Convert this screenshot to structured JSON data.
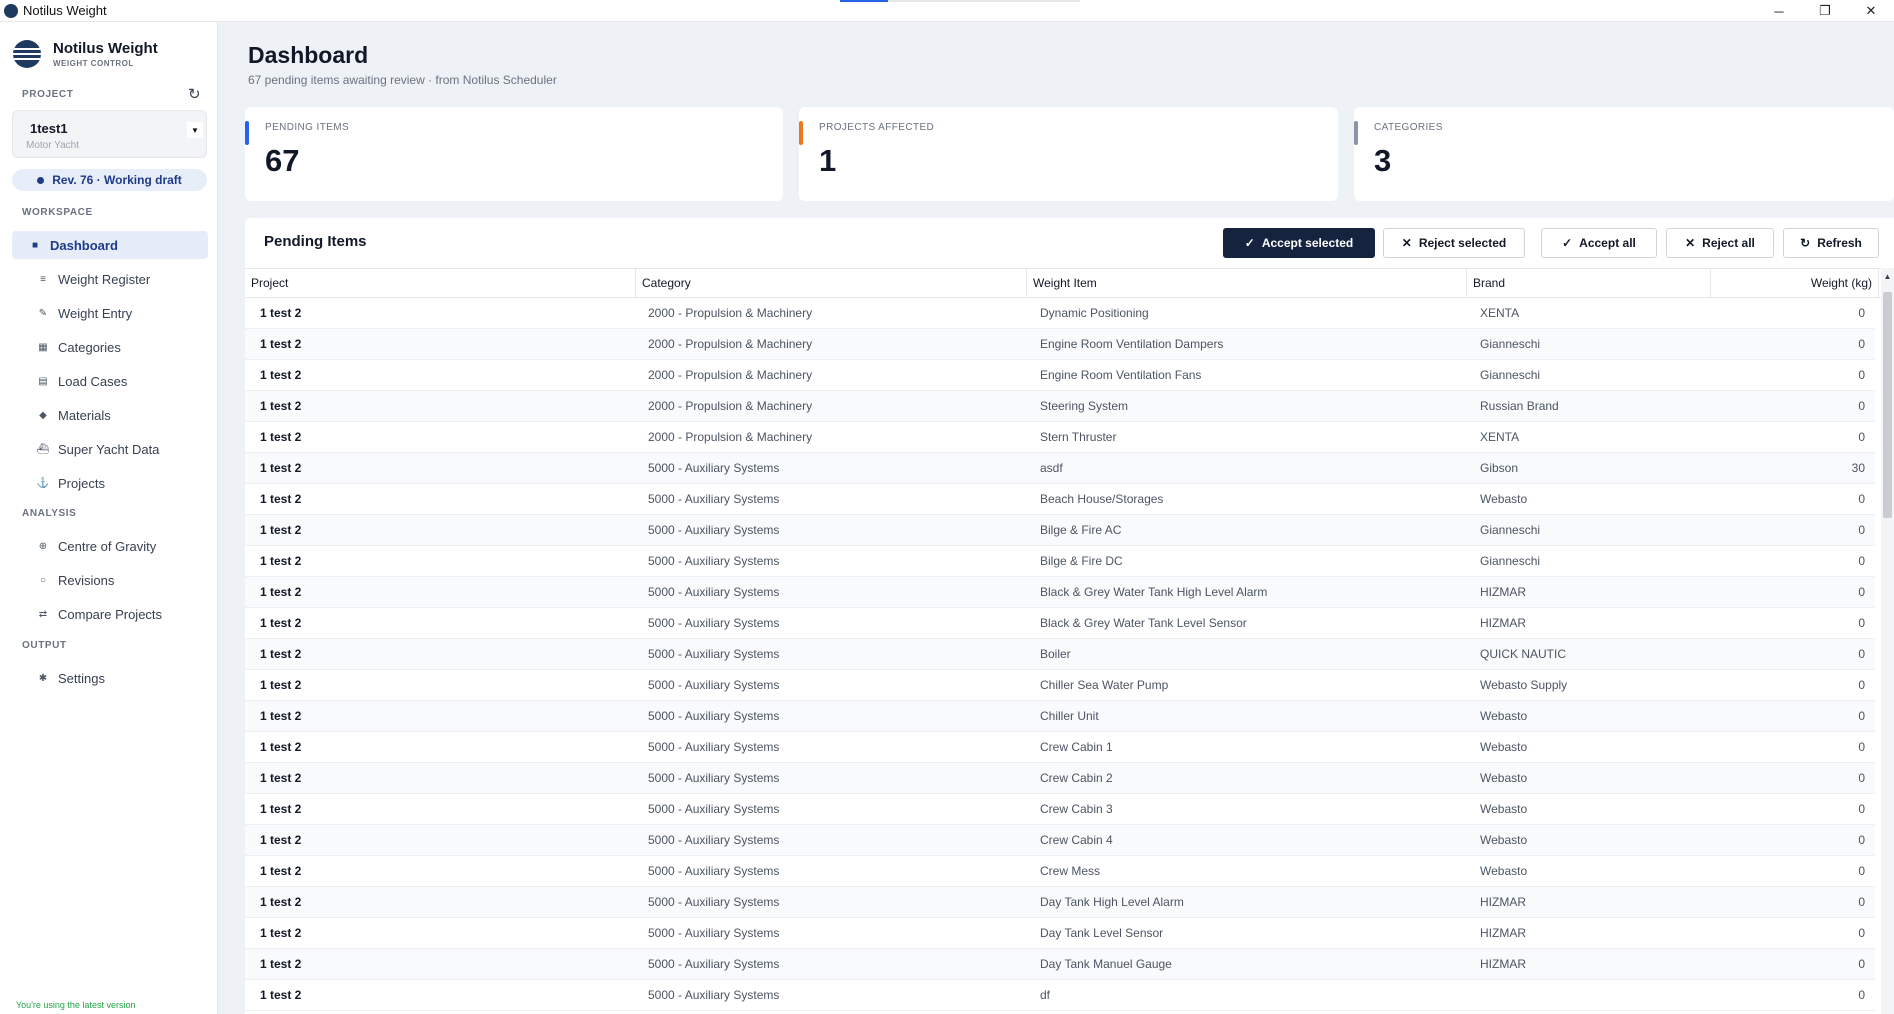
{
  "window": {
    "title": "Notilus Weight",
    "minimize_glyph": "─",
    "maximize_glyph": "❐",
    "close_glyph": "✕",
    "loading_progress": 0.2
  },
  "sidebar": {
    "brand_name": "Notilus Weight",
    "brand_sub": "WEIGHT CONTROL",
    "project_label": "PROJECT",
    "refresh_glyph": "↻",
    "project": {
      "name": "1test1",
      "type": "Motor Yacht",
      "caret": "▼"
    },
    "revision": "Rev. 76  ·  Working draft",
    "sections": {
      "workspace": "WORKSPACE",
      "analysis": "ANALYSIS",
      "output": "OUTPUT"
    },
    "nav": {
      "dashboard": {
        "label": "Dashboard",
        "icon": "■"
      },
      "weight_register": {
        "label": "Weight Register",
        "icon": "≡"
      },
      "weight_entry": {
        "label": "Weight Entry",
        "icon": "✎"
      },
      "categories": {
        "label": "Categories",
        "icon": "▦"
      },
      "load_cases": {
        "label": "Load Cases",
        "icon": "▤"
      },
      "materials": {
        "label": "Materials",
        "icon": "◆"
      },
      "super_yacht_data": {
        "label": "Super Yacht Data",
        "icon": "⛴"
      },
      "projects": {
        "label": "Projects",
        "icon": "⚓"
      },
      "centre_of_gravity": {
        "label": "Centre of Gravity",
        "icon": "⊕"
      },
      "revisions": {
        "label": "Revisions",
        "icon": "○"
      },
      "compare_projects": {
        "label": "Compare Projects",
        "icon": "⇄"
      },
      "settings": {
        "label": "Settings",
        "icon": "✱"
      }
    },
    "version_note": "You're using the latest version"
  },
  "header": {
    "title": "Dashboard",
    "subtitle": "67 pending items awaiting review · from Notilus Scheduler"
  },
  "stats": {
    "pending": {
      "label": "PENDING ITEMS",
      "value": "67",
      "color": "#2563eb"
    },
    "projects": {
      "label": "PROJECTS AFFECTED",
      "value": "1",
      "color": "#ea7a1b"
    },
    "categories": {
      "label": "CATEGORIES",
      "value": "3",
      "color": "#8b93a7"
    }
  },
  "panel": {
    "title": "Pending Items",
    "buttons": {
      "accept_selected": {
        "label": "Accept selected",
        "icon": "✓"
      },
      "reject_selected": {
        "label": "Reject selected",
        "icon": "✕"
      },
      "accept_all": {
        "label": "Accept all",
        "icon": "✓"
      },
      "reject_all": {
        "label": "Reject all",
        "icon": "✕"
      },
      "refresh": {
        "label": "Refresh",
        "icon": "↻"
      }
    },
    "columns": {
      "project": "Project",
      "category": "Category",
      "item": "Weight Item",
      "brand": "Brand",
      "weight": "Weight (kg)"
    },
    "scroll_up_glyph": "▲",
    "rows": [
      {
        "project": "1 test 2",
        "category": "2000 - Propulsion & Machinery",
        "item": "Dynamic Positioning",
        "brand": "XENTA",
        "weight": "0"
      },
      {
        "project": "1 test 2",
        "category": "2000 - Propulsion & Machinery",
        "item": "Engine Room Ventilation Dampers",
        "brand": "Gianneschi",
        "weight": "0"
      },
      {
        "project": "1 test 2",
        "category": "2000 - Propulsion & Machinery",
        "item": "Engine Room Ventilation Fans",
        "brand": "Gianneschi",
        "weight": "0"
      },
      {
        "project": "1 test 2",
        "category": "2000 - Propulsion & Machinery",
        "item": "Steering System",
        "brand": "Russian Brand",
        "weight": "0"
      },
      {
        "project": "1 test 2",
        "category": "2000 - Propulsion & Machinery",
        "item": "Stern Thruster",
        "brand": "XENTA",
        "weight": "0"
      },
      {
        "project": "1 test 2",
        "category": "5000 - Auxiliary Systems",
        "item": "asdf",
        "brand": "Gibson",
        "weight": "30"
      },
      {
        "project": "1 test 2",
        "category": "5000 - Auxiliary Systems",
        "item": "Beach House/Storages",
        "brand": "Webasto",
        "weight": "0"
      },
      {
        "project": "1 test 2",
        "category": "5000 - Auxiliary Systems",
        "item": "Bilge & Fire AC",
        "brand": "Gianneschi",
        "weight": "0"
      },
      {
        "project": "1 test 2",
        "category": "5000 - Auxiliary Systems",
        "item": "Bilge & Fire DC",
        "brand": "Gianneschi",
        "weight": "0"
      },
      {
        "project": "1 test 2",
        "category": "5000 - Auxiliary Systems",
        "item": "Black & Grey Water Tank High Level Alarm",
        "brand": "HIZMAR",
        "weight": "0"
      },
      {
        "project": "1 test 2",
        "category": "5000 - Auxiliary Systems",
        "item": "Black & Grey Water Tank Level Sensor",
        "brand": "HIZMAR",
        "weight": "0"
      },
      {
        "project": "1 test 2",
        "category": "5000 - Auxiliary Systems",
        "item": "Boiler",
        "brand": "QUICK NAUTIC",
        "weight": "0"
      },
      {
        "project": "1 test 2",
        "category": "5000 - Auxiliary Systems",
        "item": "Chiller Sea Water Pump",
        "brand": "Webasto Supply",
        "weight": "0"
      },
      {
        "project": "1 test 2",
        "category": "5000 - Auxiliary Systems",
        "item": "Chiller Unit",
        "brand": "Webasto",
        "weight": "0"
      },
      {
        "project": "1 test 2",
        "category": "5000 - Auxiliary Systems",
        "item": "Crew Cabin 1",
        "brand": "Webasto",
        "weight": "0"
      },
      {
        "project": "1 test 2",
        "category": "5000 - Auxiliary Systems",
        "item": "Crew Cabin 2",
        "brand": "Webasto",
        "weight": "0"
      },
      {
        "project": "1 test 2",
        "category": "5000 - Auxiliary Systems",
        "item": "Crew Cabin 3",
        "brand": "Webasto",
        "weight": "0"
      },
      {
        "project": "1 test 2",
        "category": "5000 - Auxiliary Systems",
        "item": "Crew Cabin 4",
        "brand": "Webasto",
        "weight": "0"
      },
      {
        "project": "1 test 2",
        "category": "5000 - Auxiliary Systems",
        "item": "Crew Mess",
        "brand": "Webasto",
        "weight": "0"
      },
      {
        "project": "1 test 2",
        "category": "5000 - Auxiliary Systems",
        "item": "Day Tank High Level Alarm",
        "brand": "HIZMAR",
        "weight": "0"
      },
      {
        "project": "1 test 2",
        "category": "5000 - Auxiliary Systems",
        "item": "Day Tank Level Sensor",
        "brand": "HIZMAR",
        "weight": "0"
      },
      {
        "project": "1 test 2",
        "category": "5000 - Auxiliary Systems",
        "item": "Day Tank Manuel Gauge",
        "brand": "HIZMAR",
        "weight": "0"
      },
      {
        "project": "1 test 2",
        "category": "5000 - Auxiliary Systems",
        "item": "df",
        "brand": "",
        "weight": "0"
      }
    ]
  }
}
